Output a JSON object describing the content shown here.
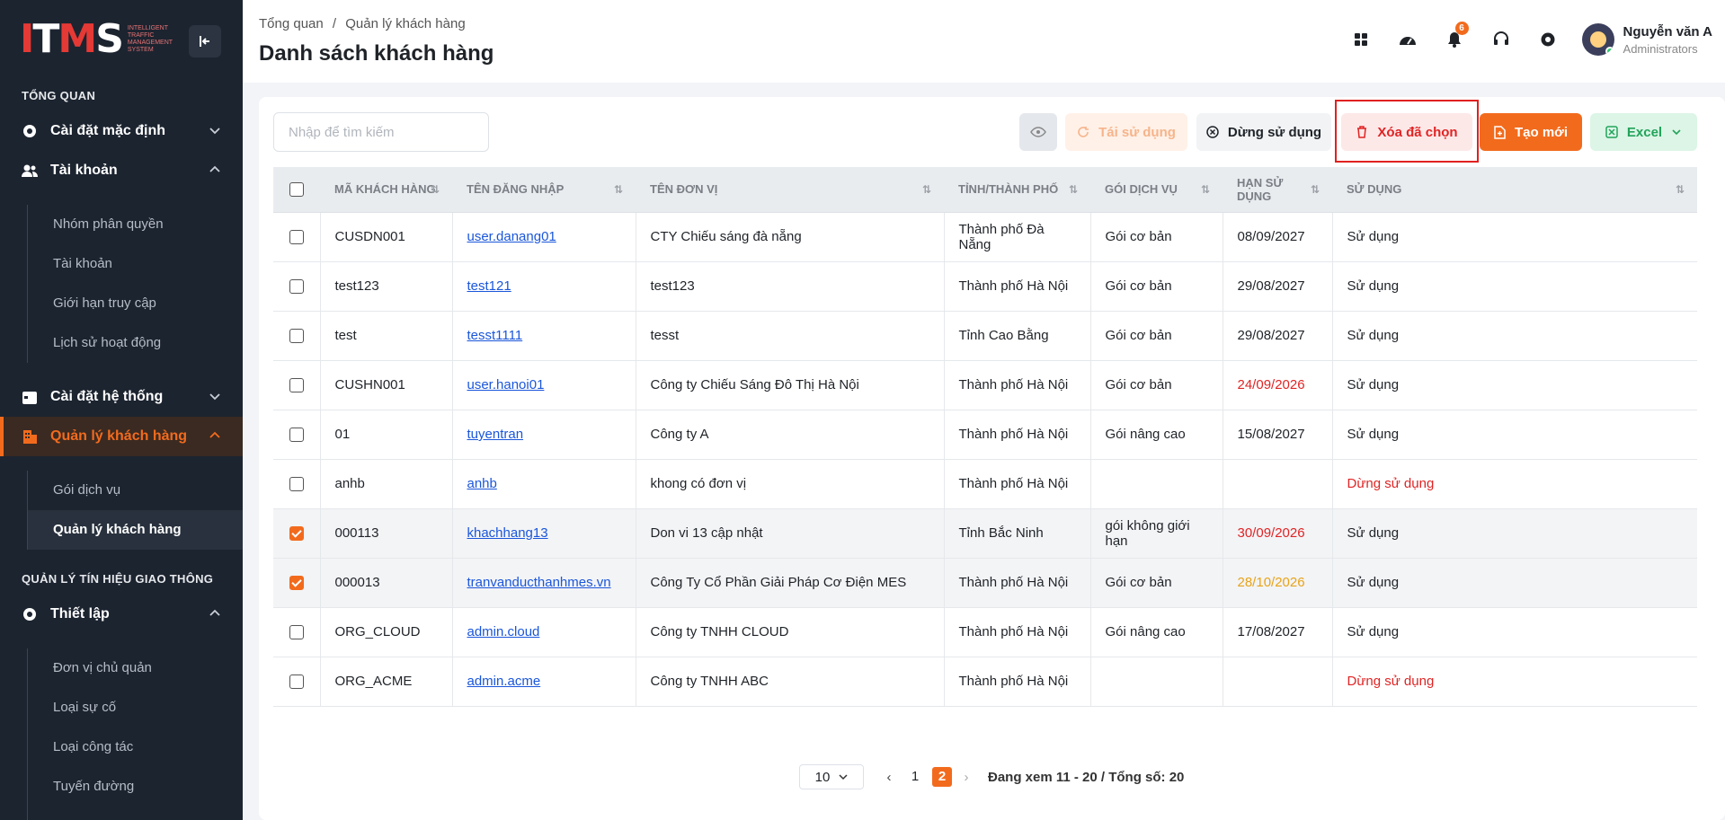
{
  "logo": {
    "main": "ITMS",
    "sub": "INTELLIGENT TRAFFIC MANAGEMENT SYSTEM"
  },
  "sidebar": {
    "section1": "TỔNG QUAN",
    "section2": "QUẢN LÝ TÍN HIỆU GIAO THÔNG",
    "menu": {
      "default_settings": "Cài đặt mặc định",
      "accounts": "Tài khoản",
      "system_settings": "Cài đặt hệ thống",
      "customers": "Quản lý khách hàng",
      "setup": "Thiết lập"
    },
    "accounts_sub": [
      "Nhóm phân quyền",
      "Tài khoản",
      "Giới hạn truy cập",
      "Lịch sử hoạt động"
    ],
    "customers_sub": [
      "Gói dịch vụ",
      "Quản lý khách hàng"
    ],
    "setup_sub": [
      "Đơn vị chủ quản",
      "Loại sự cố",
      "Loại công tác",
      "Tuyến đường"
    ]
  },
  "header": {
    "breadcrumb_home": "Tổng quan",
    "breadcrumb_sep": "/",
    "breadcrumb_current": "Quản lý khách hàng",
    "title": "Danh sách khách hàng",
    "notification_count": "6",
    "user_name": "Nguyễn văn A",
    "user_role": "Administrators"
  },
  "toolbar": {
    "search_placeholder": "Nhập để tìm kiếm",
    "reuse_label": "Tái sử dụng",
    "stop_label": "Dừng sử dụng",
    "delete_label": "Xóa đã chọn",
    "create_label": "Tạo mới",
    "excel_label": "Excel"
  },
  "table": {
    "headers": [
      "MÃ KHÁCH HÀNG",
      "TÊN ĐĂNG NHẬP",
      "TÊN ĐƠN VỊ",
      "TỈNH/THÀNH PHỐ",
      "GÓI DỊCH VỤ",
      "HẠN SỬ DỤNG",
      "SỬ DỤNG"
    ],
    "rows": [
      {
        "checked": false,
        "code": "CUSDN001",
        "username": "user.danang01",
        "unit": "CTY Chiếu sáng đà nẵng",
        "province": "Thành phố Đà Nẵng",
        "package": "Gói cơ bản",
        "expiry": "08/09/2027",
        "expiry_status": "normal",
        "usage": "Sử dụng",
        "usage_status": "normal"
      },
      {
        "checked": false,
        "code": "test123",
        "username": "test121",
        "unit": "test123",
        "province": "Thành phố Hà Nội",
        "package": "Gói cơ bản",
        "expiry": "29/08/2027",
        "expiry_status": "normal",
        "usage": "Sử dụng",
        "usage_status": "normal"
      },
      {
        "checked": false,
        "code": "test",
        "username": "tesst1111",
        "unit": "tesst",
        "province": "Tỉnh Cao Bằng",
        "package": "Gói cơ bản",
        "expiry": "29/08/2027",
        "expiry_status": "normal",
        "usage": "Sử dụng",
        "usage_status": "normal"
      },
      {
        "checked": false,
        "code": "CUSHN001",
        "username": "user.hanoi01",
        "unit": "Công ty Chiếu Sáng Đô Thị Hà Nội",
        "province": "Thành phố Hà Nội",
        "package": "Gói cơ bản",
        "expiry": "24/09/2026",
        "expiry_status": "red",
        "usage": "Sử dụng",
        "usage_status": "normal"
      },
      {
        "checked": false,
        "code": "01",
        "username": "tuyentran",
        "unit": "Công ty A",
        "province": "Thành phố Hà Nội",
        "package": "Gói nâng cao",
        "expiry": "15/08/2027",
        "expiry_status": "normal",
        "usage": "Sử dụng",
        "usage_status": "normal"
      },
      {
        "checked": false,
        "code": "anhb",
        "username": "anhb",
        "unit": "khong có đơn vị",
        "province": "Thành phố Hà Nội",
        "package": "",
        "expiry": "",
        "expiry_status": "normal",
        "usage": "Dừng sử dụng",
        "usage_status": "red"
      },
      {
        "checked": true,
        "code": "000113",
        "username": "khachhang13",
        "unit": "Don vi 13 cập nhật",
        "province": "Tỉnh Bắc Ninh",
        "package": "gói không giới hạn",
        "expiry": "30/09/2026",
        "expiry_status": "red",
        "usage": "Sử dụng",
        "usage_status": "normal"
      },
      {
        "checked": true,
        "code": "000013",
        "username": "tranvanducthanhmes.vn",
        "unit": "Công Ty Cổ Phần Giải Pháp Cơ Điện MES",
        "province": "Thành phố Hà Nội",
        "package": "Gói cơ bản",
        "expiry": "28/10/2026",
        "expiry_status": "orange",
        "usage": "Sử dụng",
        "usage_status": "normal"
      },
      {
        "checked": false,
        "code": "ORG_CLOUD",
        "username": "admin.cloud",
        "unit": "Công ty TNHH CLOUD",
        "province": "Thành phố Hà Nội",
        "package": "Gói nâng cao",
        "expiry": "17/08/2027",
        "expiry_status": "normal",
        "usage": "Sử dụng",
        "usage_status": "normal"
      },
      {
        "checked": false,
        "code": "ORG_ACME",
        "username": "admin.acme",
        "unit": "Công ty TNHH ABC",
        "province": "Thành phố Hà Nội",
        "package": "",
        "expiry": "",
        "expiry_status": "normal",
        "usage": "Dừng sử dụng",
        "usage_status": "red"
      }
    ]
  },
  "pagination": {
    "page_size": "10",
    "pages": [
      "1",
      "2"
    ],
    "current": "2",
    "info": "Đang xem 11 - 20 / Tổng số: 20"
  },
  "colors": {
    "accent": "#f26b1d",
    "sidebar_bg": "#1c2430",
    "danger": "#e02424",
    "link": "#1a56db"
  }
}
